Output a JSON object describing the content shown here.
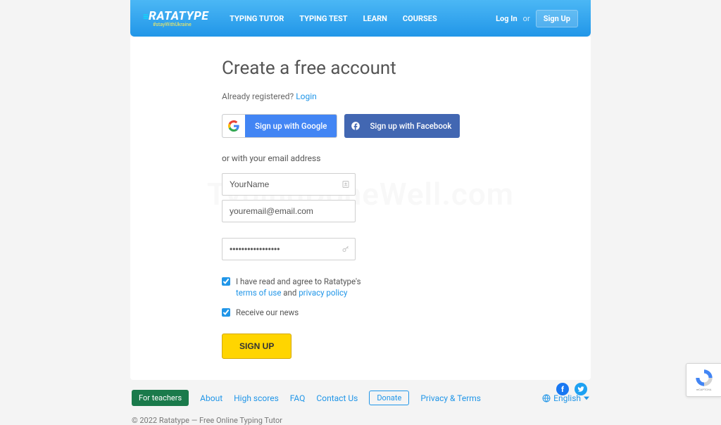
{
  "header": {
    "logo": "RATATYPE",
    "tagline": "#stayWithUkraine",
    "nav": [
      "TYPING TUTOR",
      "TYPING TEST",
      "LEARN",
      "COURSES"
    ],
    "login": "Log In",
    "or": "or",
    "signup": "Sign Up"
  },
  "form": {
    "title": "Create a free account",
    "already_prefix": "Already registered? ",
    "already_link": "Login",
    "google_label": "Sign up with Google",
    "facebook_label": "Sign up with Facebook",
    "or_email": "or with your email address",
    "name_value": "YourName",
    "email_value": "youremail@email.com",
    "password_value": "•••••••••••••••••",
    "terms_prefix": "I have read and agree to Ratatype's ",
    "terms_link": "terms of use",
    "terms_and": " and ",
    "privacy_link": "privacy policy",
    "news_label": "Receive our news",
    "submit": "SIGN UP"
  },
  "footer": {
    "teachers": "For teachers",
    "links": [
      "About",
      "High scores",
      "FAQ",
      "Contact Us"
    ],
    "donate": "Donate",
    "privacy": "Privacy & Terms",
    "language": "English",
    "copyright": "© 2022 Ratatype — Free Online Typing Tutor"
  },
  "watermark": "TypingDoneWell.com"
}
